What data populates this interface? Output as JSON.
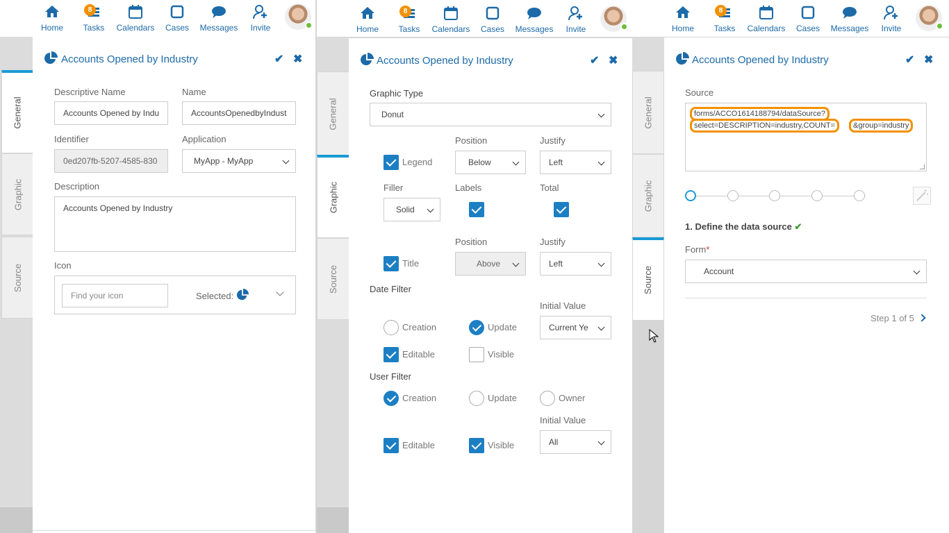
{
  "nav": {
    "home": "Home",
    "tasks": "Tasks",
    "tasks_badge": "8",
    "calendars": "Calendars",
    "cases": "Cases",
    "messages": "Messages",
    "invite": "Invite"
  },
  "dialog_title": "Accounts Opened by Industry",
  "tabs": {
    "general": "General",
    "graphic": "Graphic",
    "source": "Source"
  },
  "general": {
    "descriptive_name_label": "Descriptive Name",
    "descriptive_name_value": "Accounts Opened by Indu",
    "name_label": "Name",
    "name_value": "AccountsOpenedbyIndust",
    "identifier_label": "Identifier",
    "identifier_value": "0ed207fb-5207-4585-830",
    "application_label": "Application",
    "application_value": "MyApp - MyApp",
    "description_label": "Description",
    "description_value": "Accounts Opened by Industry",
    "icon_label": "Icon",
    "icon_placeholder": "Find your icon",
    "icon_selected_label": "Selected:",
    "icon_selected": "pie-chart-icon"
  },
  "graphic": {
    "graphic_type_label": "Graphic Type",
    "graphic_type_value": "Donut",
    "position_label": "Position",
    "justify_label": "Justify",
    "legend_label": "Legend",
    "legend_checked": true,
    "legend_position": "Below",
    "legend_justify": "Left",
    "filler_label": "Filler",
    "filler_value": "Solid",
    "labels_label": "Labels",
    "labels_checked": true,
    "total_label": "Total",
    "total_checked": true,
    "title_label": "Title",
    "title_checked": true,
    "title_position": "Above",
    "title_justify": "Left",
    "date_filter_label": "Date Filter",
    "initial_value_label": "Initial Value",
    "date_creation": "Creation",
    "date_update": "Update",
    "date_initial_value": "Current Ye",
    "date_editable": "Editable",
    "date_visible": "Visible",
    "user_filter_label": "User Filter",
    "user_creation": "Creation",
    "user_update": "Update",
    "user_owner": "Owner",
    "user_initial_value": "All",
    "user_editable": "Editable",
    "user_visible": "Visible"
  },
  "source": {
    "source_label": "Source",
    "source_line1": "forms/ACCO1614188794/dataSource?",
    "source_line2a": "select=DESCRIPTION=industry,COUNT=",
    "source_line2b": "&group=industry",
    "step_heading": "1. Define the data source",
    "form_label": "Form",
    "form_required": "*",
    "form_value": "Account",
    "step_counter": "Step 1 of 5"
  },
  "colors": {
    "accent": "#1c6aa8",
    "tab_active": "#1a9ad6",
    "badge": "#f29100",
    "highlight": "#f29100",
    "check_green": "#3a9c2e"
  }
}
